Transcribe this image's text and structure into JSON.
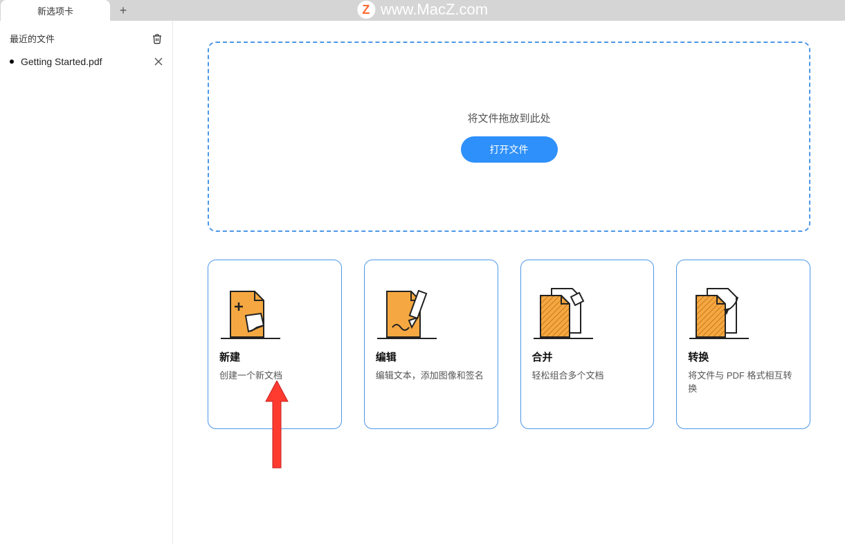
{
  "watermark": {
    "letter": "Z",
    "text": "www.MacZ.com"
  },
  "tabs": {
    "active": "新选项卡"
  },
  "sidebar": {
    "title": "最近的文件",
    "files": [
      {
        "name": "Getting Started.pdf"
      }
    ]
  },
  "dropzone": {
    "hint": "将文件拖放到此处",
    "open_button": "打开文件"
  },
  "cards": [
    {
      "key": "create",
      "title": "新建",
      "desc": "创建一个新文档"
    },
    {
      "key": "edit",
      "title": "编辑",
      "desc": "编辑文本，添加图像和签名"
    },
    {
      "key": "merge",
      "title": "合并",
      "desc": "轻松组合多个文档"
    },
    {
      "key": "convert",
      "title": "转换",
      "desc": "将文件与 PDF 格式相互转换"
    }
  ]
}
